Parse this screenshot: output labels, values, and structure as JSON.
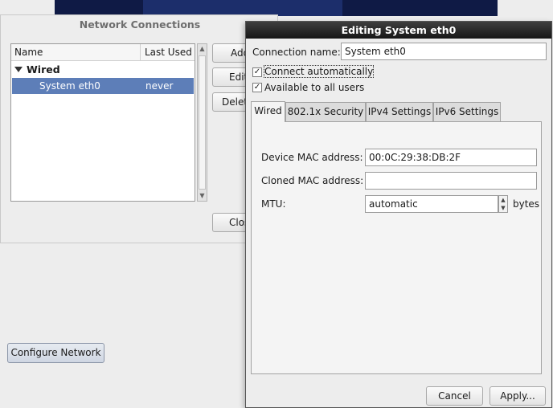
{
  "network_connections": {
    "title": "Network Connections",
    "columns": [
      "Name",
      "Last Used"
    ],
    "group_label": "Wired",
    "connection": {
      "name": "System eth0",
      "last_used": "never"
    },
    "buttons": {
      "add": "Add",
      "edit": "Edit...",
      "delete": "Delete...",
      "close": "Close"
    }
  },
  "configure_network_label": "Configure Network",
  "dialog": {
    "title": "Editing System eth0",
    "connection_name_label": "Connection name:",
    "connection_name_value": "System eth0",
    "connect_automatically": {
      "label": "Connect automatically",
      "checked": true
    },
    "available_to_all": {
      "label": "Available to all users",
      "checked": true
    },
    "tabs": [
      "Wired",
      "802.1x Security",
      "IPv4 Settings",
      "IPv6 Settings"
    ],
    "active_tab": "Wired",
    "wired": {
      "device_mac_label": "Device MAC address:",
      "device_mac_value": "00:0C:29:38:DB:2F",
      "cloned_mac_label": "Cloned MAC address:",
      "cloned_mac_value": "",
      "mtu_label": "MTU:",
      "mtu_value": "automatic",
      "mtu_unit": "bytes"
    },
    "buttons": {
      "cancel": "Cancel",
      "apply": "Apply..."
    }
  }
}
